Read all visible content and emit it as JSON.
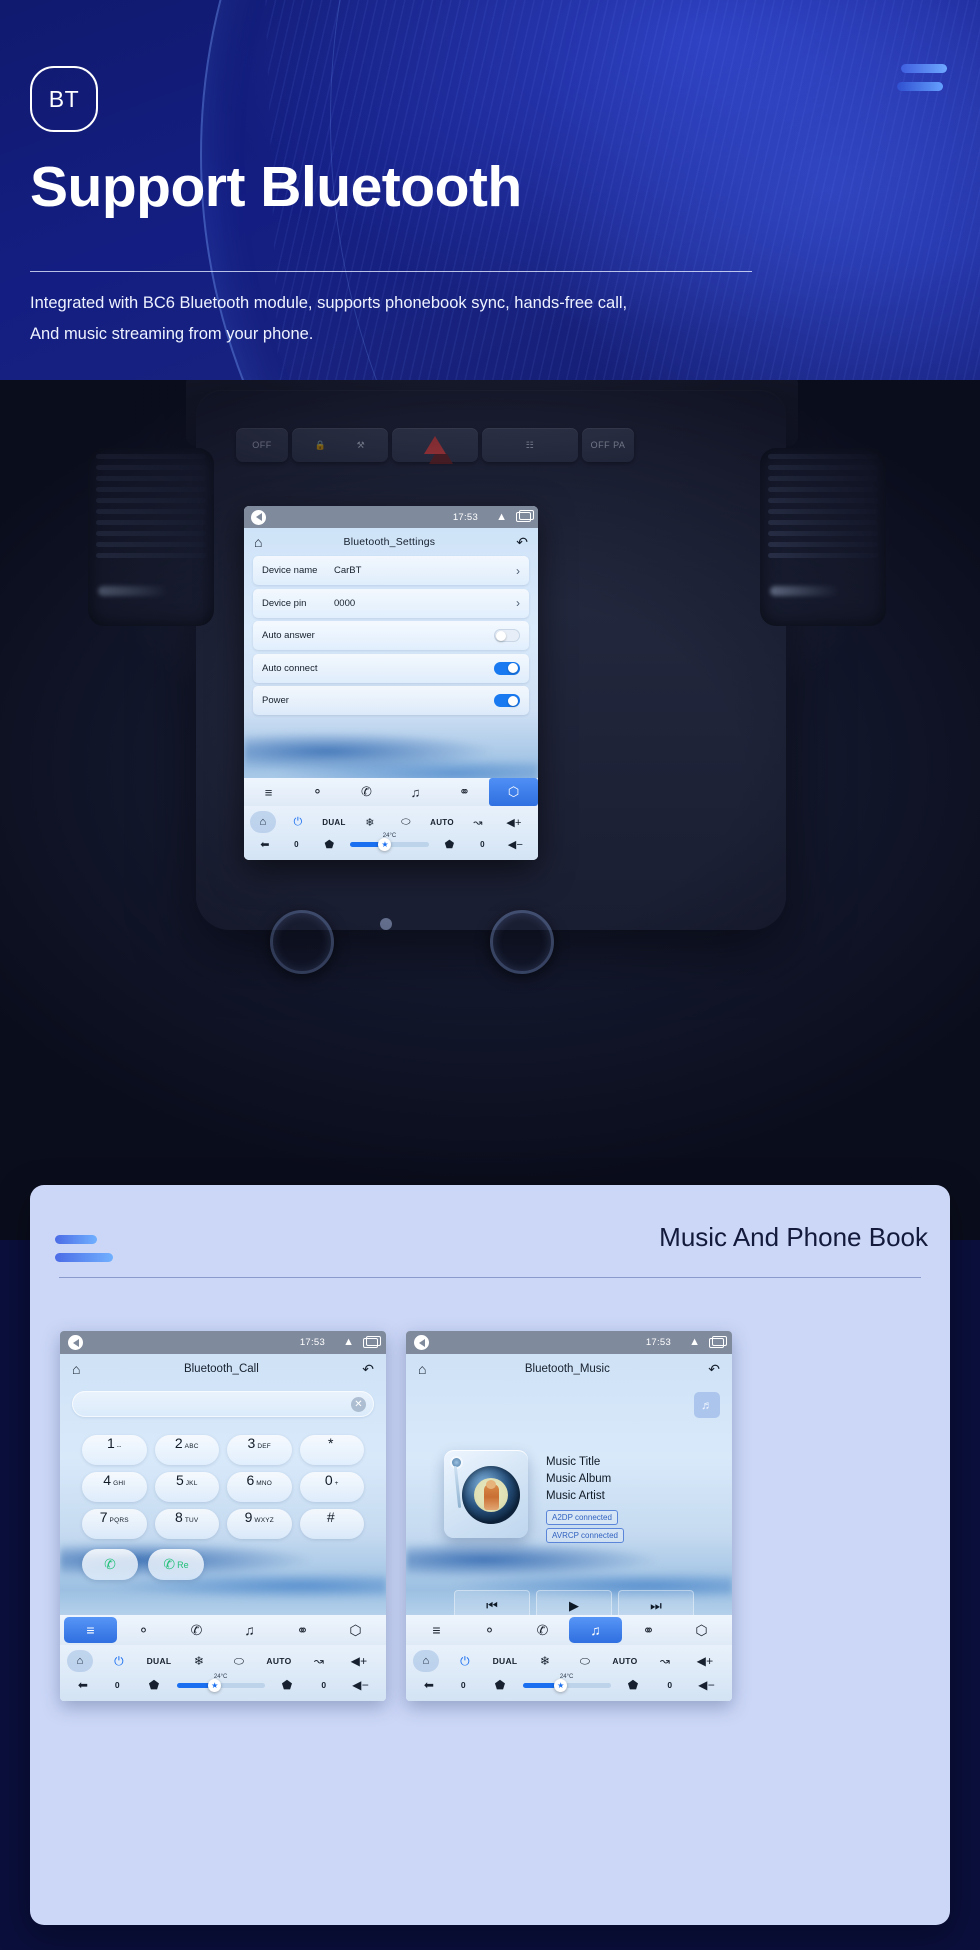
{
  "hero": {
    "badge": "BT",
    "title": "Support Bluetooth",
    "subtitle_line1": "Integrated with BC6 Bluetooth module, supports phonebook sync, hands-free call,",
    "subtitle_line2": "And music streaming from your phone.",
    "accent": "#5b8cff",
    "background": "#141e82"
  },
  "head_unit": {
    "status": {
      "time": "17:53",
      "back_icon": "back-triangle-icon",
      "chevron_icon": "chevron-up-icon",
      "recents_icon": "recents-icon"
    },
    "home_icon": "home-icon",
    "title": "Bluetooth_Settings",
    "back_icon": "return-arrow-icon",
    "rows": [
      {
        "label": "Device name",
        "value": "CarBT",
        "control": "chevron",
        "chevron": "›"
      },
      {
        "label": "Device pin",
        "value": "0000",
        "control": "chevron",
        "chevron": "›"
      },
      {
        "label": "Auto answer",
        "value": "",
        "control": "toggle",
        "toggle": "off"
      },
      {
        "label": "Auto connect",
        "value": "",
        "control": "toggle",
        "toggle": "on"
      },
      {
        "label": "Power",
        "value": "",
        "control": "toggle",
        "toggle": "on"
      }
    ],
    "dock": [
      {
        "name": "apps",
        "glyph": "≡",
        "active": false
      },
      {
        "name": "contacts",
        "glyph": "⚬",
        "active": false
      },
      {
        "name": "phone",
        "glyph": "✆",
        "active": false
      },
      {
        "name": "music",
        "glyph": "♫",
        "active": false
      },
      {
        "name": "link",
        "glyph": "⚭",
        "active": false
      },
      {
        "name": "settings",
        "glyph": "⬡",
        "active": true
      }
    ],
    "climate": {
      "home": "⌂",
      "power": "⏻",
      "dual": "DUAL",
      "snow": "❄",
      "defog": "⬭",
      "auto": "AUTO",
      "airflow": "↝",
      "vol_up": "◀+",
      "vol_down": "◀−",
      "back": "⬅",
      "fan_left": "0",
      "fan_right": "0",
      "seat_left": "⬟",
      "seat_right": "⬟",
      "temp": "24°C"
    }
  },
  "dash": {
    "buttons": [
      {
        "name": "traction-off",
        "label": "OFF"
      },
      {
        "name": "door-lock",
        "label": ""
      },
      {
        "name": "child-lock",
        "label": ""
      },
      {
        "name": "hazard",
        "label": ""
      },
      {
        "name": "rear-defrost",
        "label": ""
      },
      {
        "name": "park-assist",
        "label": "OFF PA"
      }
    ]
  },
  "card": {
    "title": "Music And Phone Book"
  },
  "call_screen": {
    "status": {
      "time": "17:53"
    },
    "title": "Bluetooth_Call",
    "home_icon": "home-icon",
    "back_icon": "return-arrow-icon",
    "input_value": "",
    "clear_label": "✕",
    "keys": [
      {
        "digit": "1",
        "sub": "--"
      },
      {
        "digit": "2",
        "sub": "ABC"
      },
      {
        "digit": "3",
        "sub": "DEF"
      },
      {
        "digit": "*",
        "sub": ""
      },
      {
        "digit": "4",
        "sub": "GHI"
      },
      {
        "digit": "5",
        "sub": "JKL"
      },
      {
        "digit": "6",
        "sub": "MNO"
      },
      {
        "digit": "0",
        "sub": "+"
      },
      {
        "digit": "7",
        "sub": "PQRS"
      },
      {
        "digit": "8",
        "sub": "TUV"
      },
      {
        "digit": "9",
        "sub": "WXYZ"
      },
      {
        "digit": "#",
        "sub": ""
      }
    ],
    "call_button": "✆",
    "redial_button_icon": "✆",
    "redial_button_label": "Re",
    "dock": [
      {
        "name": "apps",
        "glyph": "≡",
        "active": true
      },
      {
        "name": "contacts",
        "glyph": "⚬",
        "active": false
      },
      {
        "name": "phone",
        "glyph": "✆",
        "active": false
      },
      {
        "name": "music",
        "glyph": "♫",
        "active": false
      },
      {
        "name": "link",
        "glyph": "⚭",
        "active": false
      },
      {
        "name": "settings",
        "glyph": "⬡",
        "active": false
      }
    ]
  },
  "music_screen": {
    "status": {
      "time": "17:53"
    },
    "title": "Bluetooth_Music",
    "home_icon": "home-icon",
    "back_icon": "return-arrow-icon",
    "source_badge_icon": "music-note-icon",
    "meta": {
      "title": "Music Title",
      "album": "Music Album",
      "artist": "Music Artist",
      "a2dp": "A2DP  connected",
      "avrcp": "AVRCP connected"
    },
    "controls": [
      {
        "name": "previous",
        "glyph": "⏮"
      },
      {
        "name": "play",
        "glyph": "▶"
      },
      {
        "name": "next",
        "glyph": "⏭"
      }
    ],
    "dock": [
      {
        "name": "apps",
        "glyph": "≡",
        "active": false
      },
      {
        "name": "contacts",
        "glyph": "⚬",
        "active": false
      },
      {
        "name": "phone",
        "glyph": "✆",
        "active": false
      },
      {
        "name": "music",
        "glyph": "♫",
        "active": true
      },
      {
        "name": "link",
        "glyph": "⚭",
        "active": false
      },
      {
        "name": "settings",
        "glyph": "⬡",
        "active": false
      }
    ]
  },
  "climate_shared": {
    "home": "⌂",
    "power": "⏻",
    "dual": "DUAL",
    "snow": "❄",
    "defog": "⬭",
    "auto": "AUTO",
    "airflow": "↝",
    "vol_up": "◀+",
    "vol_down": "◀−",
    "back": "⬅",
    "fan_left": "0",
    "fan_right": "0",
    "temp": "24°C"
  }
}
